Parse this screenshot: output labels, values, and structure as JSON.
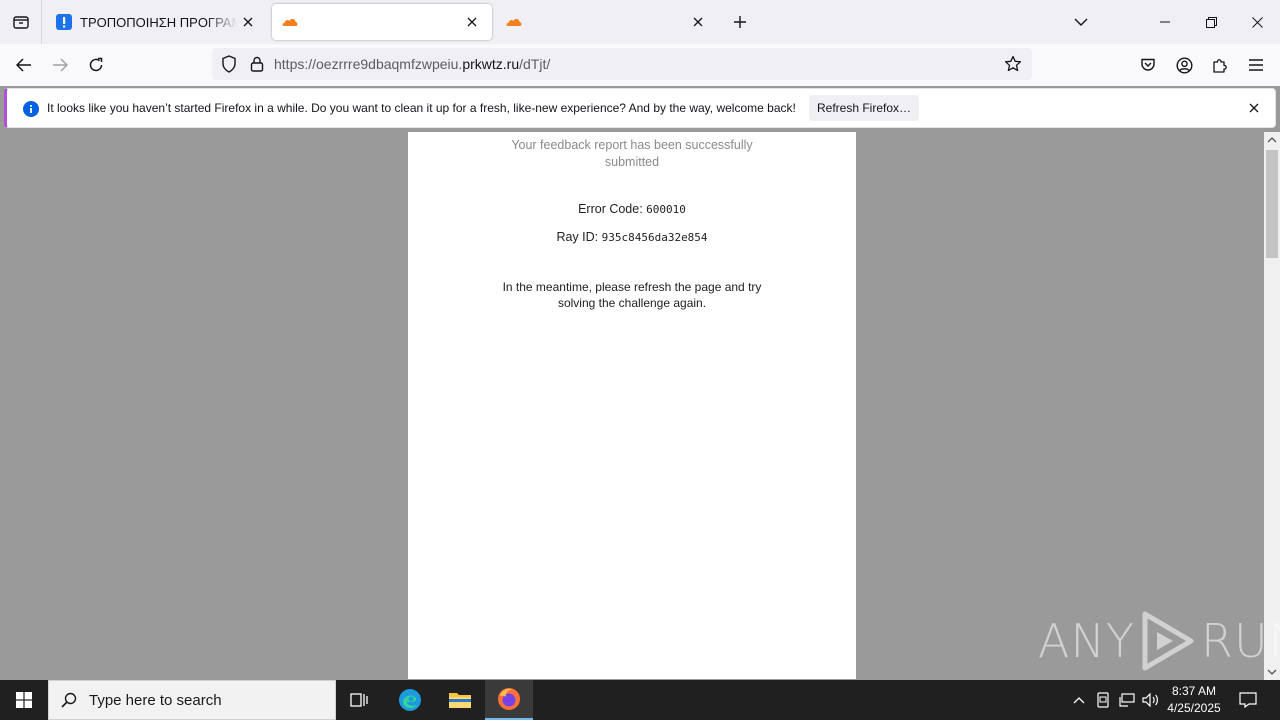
{
  "tabs": [
    {
      "title": "ΤΡΟΠΟΠΟΙΗΣΗ ΠΡΟΓΡΑΜΜΑ",
      "favicon": "exclamation-icon",
      "active": false
    },
    {
      "title": "",
      "favicon": "cloudflare-icon",
      "active": true
    },
    {
      "title": "",
      "favicon": "cloudflare-icon",
      "active": false
    }
  ],
  "navbar": {
    "url_prefix": "https://oezrrre9dbaqmfzwpeiu.",
    "url_domain": "prkwtz.ru",
    "url_path": "/dTjt/"
  },
  "notification": {
    "message": "It looks like you haven’t started Firefox in a while. Do you want to clean it up for a fresh, like-new experience? And by the way, welcome back!",
    "button_label": "Refresh Firefox…"
  },
  "page": {
    "feedback_message": "Your feedback report has been successfully submitted",
    "error_code_label": "Error Code: ",
    "error_code_value": "600010",
    "ray_id_label": "Ray ID: ",
    "ray_id_value": "935c8456da32e854",
    "instruction": "In the meantime, please refresh the page and try solving the challenge again."
  },
  "watermark": {
    "left": "ANY",
    "right": "RUN"
  },
  "taskbar": {
    "search_placeholder": "Type here to search",
    "time": "8:37 AM",
    "date": "4/25/2025"
  },
  "colors": {
    "accent": "#b04fd8",
    "cloudflare": "#f38020",
    "info": "#0060df"
  }
}
